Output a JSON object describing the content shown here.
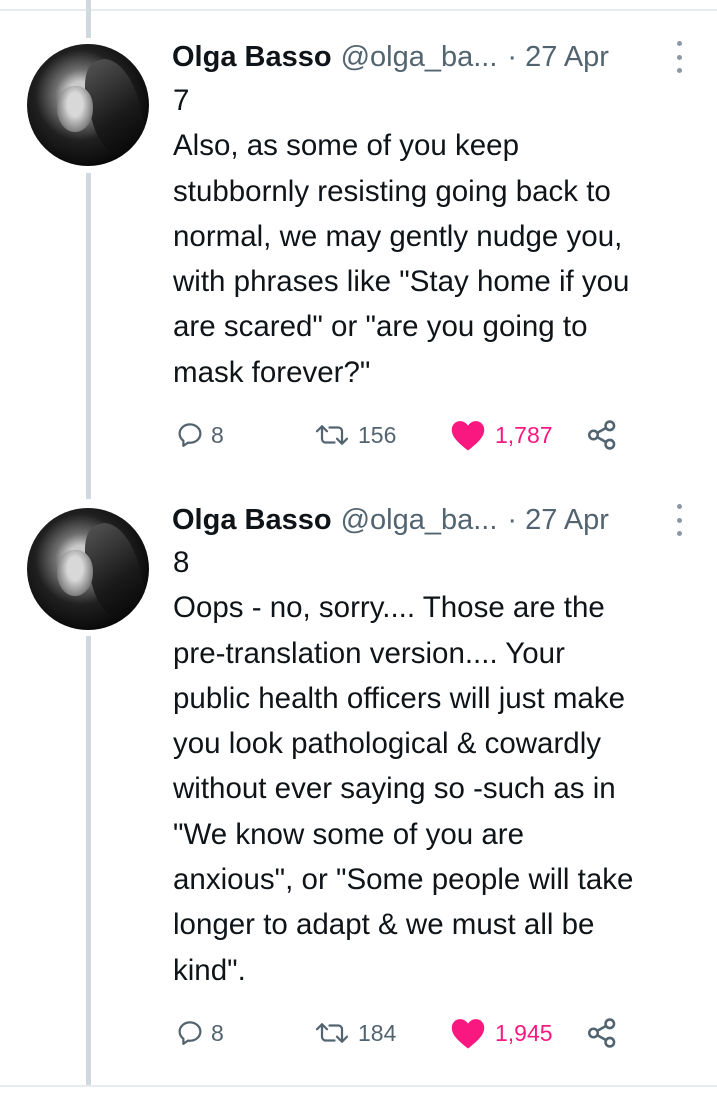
{
  "tweets": [
    {
      "author_name": "Olga Basso",
      "handle": "@olga_ba...",
      "time": "· 27 Apr",
      "thread_number": "7",
      "lines": [
        "Also, as some of you keep",
        "stubbornly resisting going back to",
        "normal, we may gently nudge you,",
        "with phrases like \"Stay home if you",
        "are scared\" or \"are you going to",
        "mask forever?\""
      ],
      "replies": "8",
      "retweets": "156",
      "likes": "1,787",
      "liked": true
    },
    {
      "author_name": "Olga Basso",
      "handle": "@olga_ba...",
      "time": "· 27 Apr",
      "thread_number": "8",
      "lines": [
        "Oops - no, sorry.... Those are the",
        "pre-translation version.... Your",
        "public health officers will just make",
        "you look pathological & cowardly",
        "without ever saying so -such as in",
        "\"We know some of you are",
        "anxious\", or \"Some people will take",
        "longer to adapt & we must all be",
        "kind\"."
      ],
      "replies": "8",
      "retweets": "184",
      "likes": "1,945",
      "liked": true
    }
  ],
  "colors": {
    "like_active": "#f91880",
    "secondary_text": "#536471",
    "thread_line": "#cfd9de"
  },
  "icons": [
    "more-options-icon",
    "reply-icon",
    "retweet-icon",
    "heart-icon",
    "share-icon"
  ]
}
